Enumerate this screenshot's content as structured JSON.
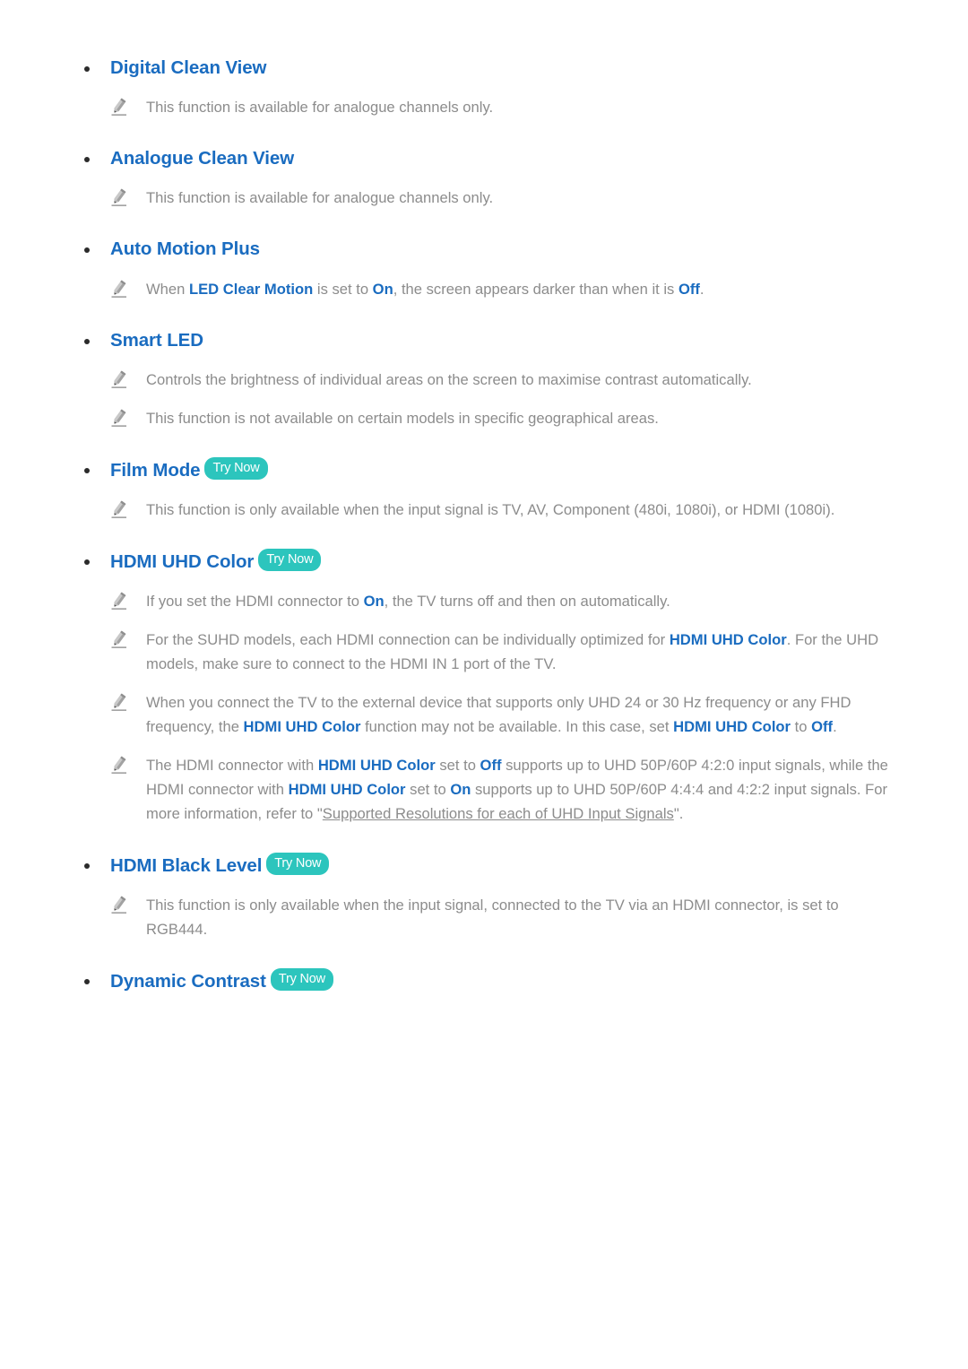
{
  "document": {
    "title": "Picture Settings Notes",
    "colors": {
      "heading_blue": "#1a6cc0",
      "body_grey": "#8c8c8c",
      "try_now_teal": "#2cc5bd",
      "bullet": "#2b2b2b",
      "background": "#ffffff"
    },
    "badge_label": "Try Now",
    "icon_names": {
      "note": "pencil-icon",
      "bullet": "bullet-dot-icon"
    }
  },
  "sections": [
    {
      "id": "digital-clean-view",
      "heading": "Digital Clean View",
      "try_now": false,
      "notes": [
        {
          "parts": [
            {
              "t": "This function is available for analogue channels only.",
              "style": "plain"
            }
          ]
        }
      ]
    },
    {
      "id": "analogue-clean-view",
      "heading": "Analogue Clean View",
      "try_now": false,
      "notes": [
        {
          "parts": [
            {
              "t": "This function is available for analogue channels only.",
              "style": "plain"
            }
          ]
        }
      ]
    },
    {
      "id": "auto-motion-plus",
      "heading": "Auto Motion Plus",
      "try_now": false,
      "notes": [
        {
          "parts": [
            {
              "t": "When ",
              "style": "plain"
            },
            {
              "t": "LED Clear Motion",
              "style": "term"
            },
            {
              "t": " is set to ",
              "style": "plain"
            },
            {
              "t": "On",
              "style": "term"
            },
            {
              "t": ", the screen appears darker than when it is ",
              "style": "plain"
            },
            {
              "t": "Off",
              "style": "term"
            },
            {
              "t": ".",
              "style": "plain"
            }
          ]
        }
      ]
    },
    {
      "id": "smart-led",
      "heading": "Smart LED",
      "try_now": false,
      "notes": [
        {
          "parts": [
            {
              "t": "Controls the brightness of individual areas on the screen to maximise contrast automatically.",
              "style": "plain"
            }
          ]
        },
        {
          "parts": [
            {
              "t": "This function is not available on certain models in specific geographical areas.",
              "style": "plain"
            }
          ]
        }
      ]
    },
    {
      "id": "film-mode",
      "heading": "Film Mode",
      "try_now": true,
      "notes": [
        {
          "parts": [
            {
              "t": "This function is only available when the input signal is TV, AV, Component (480i, 1080i), or HDMI (1080i).",
              "style": "plain"
            }
          ]
        }
      ]
    },
    {
      "id": "hdmi-uhd-color",
      "heading": "HDMI UHD Color",
      "try_now": true,
      "notes": [
        {
          "parts": [
            {
              "t": "If you set the HDMI connector to ",
              "style": "plain"
            },
            {
              "t": "On",
              "style": "term"
            },
            {
              "t": ", the TV turns off and then on automatically.",
              "style": "plain"
            }
          ]
        },
        {
          "parts": [
            {
              "t": "For the SUHD models, each HDMI connection can be individually optimized for ",
              "style": "plain"
            },
            {
              "t": "HDMI UHD Color",
              "style": "term"
            },
            {
              "t": ". For the UHD models, make sure to connect to the HDMI IN 1 port of the TV.",
              "style": "plain"
            }
          ]
        },
        {
          "parts": [
            {
              "t": "When you connect the TV to the external device that supports only UHD 24 or 30 Hz frequency or any FHD frequency, the ",
              "style": "plain"
            },
            {
              "t": "HDMI UHD Color",
              "style": "term"
            },
            {
              "t": " function may not be available. In this case, set ",
              "style": "plain"
            },
            {
              "t": "HDMI UHD Color",
              "style": "term"
            },
            {
              "t": " to ",
              "style": "plain"
            },
            {
              "t": "Off",
              "style": "term"
            },
            {
              "t": ".",
              "style": "plain"
            }
          ]
        },
        {
          "parts": [
            {
              "t": "The HDMI connector with ",
              "style": "plain"
            },
            {
              "t": "HDMI UHD Color",
              "style": "term"
            },
            {
              "t": " set to ",
              "style": "plain"
            },
            {
              "t": "Off",
              "style": "term"
            },
            {
              "t": " supports up to UHD 50P/60P 4:2:0 input signals, while the HDMI connector with ",
              "style": "plain"
            },
            {
              "t": "HDMI UHD Color",
              "style": "term"
            },
            {
              "t": " set to ",
              "style": "plain"
            },
            {
              "t": "On",
              "style": "term"
            },
            {
              "t": " supports up to UHD 50P/60P 4:4:4 and 4:2:2 input signals. For more information, refer to \"",
              "style": "plain"
            },
            {
              "t": "Supported Resolutions for each of UHD Input Signals",
              "style": "link"
            },
            {
              "t": "\".",
              "style": "plain"
            }
          ]
        }
      ]
    },
    {
      "id": "hdmi-black-level",
      "heading": "HDMI Black Level",
      "try_now": true,
      "notes": [
        {
          "parts": [
            {
              "t": "This function is only available when the input signal, connected to the TV via an HDMI connector, is set to RGB444.",
              "style": "plain"
            }
          ]
        }
      ]
    },
    {
      "id": "dynamic-contrast",
      "heading": "Dynamic Contrast",
      "try_now": true,
      "notes": []
    }
  ]
}
